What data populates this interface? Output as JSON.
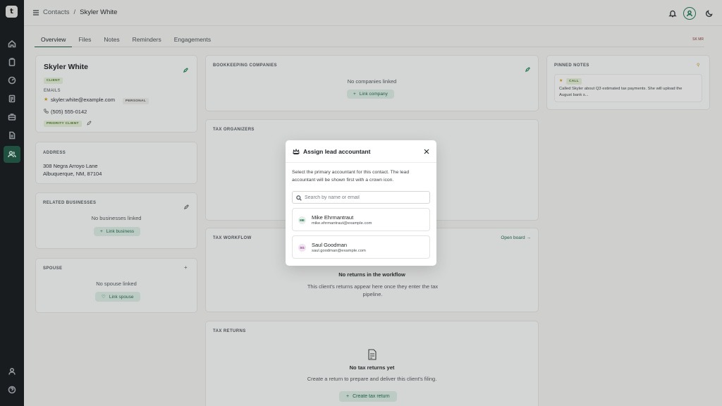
{
  "logo": {
    "glyph": "t"
  },
  "sidebar": {
    "items": [
      {
        "icon": "home-icon"
      },
      {
        "icon": "clipboard-icon"
      },
      {
        "icon": "gauge-icon"
      },
      {
        "icon": "document-icon"
      },
      {
        "icon": "briefcase-icon"
      },
      {
        "icon": "file-icon"
      },
      {
        "icon": "users-icon",
        "active": true
      }
    ],
    "bottom": [
      {
        "icon": "user-icon"
      },
      {
        "icon": "help-icon"
      }
    ]
  },
  "breadcrumb": {
    "section": "Contacts",
    "separator": "/",
    "current": "Skyler White"
  },
  "tabs": [
    "Overview",
    "Files",
    "Notes",
    "Reminders",
    "Engagements"
  ],
  "flags_label": "SK MR",
  "contact": {
    "name": "Skyler White",
    "type_badge": "CLIENT",
    "emails_label": "EMAILS",
    "email": "skyler.white@example.com",
    "email_tag": "PERSONAL",
    "phone": "(505) 555-0142",
    "priority_badge": "PRIORITY CLIENT"
  },
  "address": {
    "label": "ADDRESS",
    "line1": "308 Negra Arroyo Lane",
    "line2": "Albuquerque, NM, 87104"
  },
  "related": {
    "label": "RELATED BUSINESSES",
    "empty": "No businesses linked",
    "button": "Link business"
  },
  "spouse": {
    "label": "SPOUSE",
    "empty": "No spouse linked",
    "button": "Link spouse"
  },
  "bookkeeping": {
    "label": "BOOKKEEPING COMPANIES",
    "empty": "No companies linked",
    "button": "Link company"
  },
  "tax_organizers": {
    "label": "TAX ORGANIZERS"
  },
  "tax_workflow": {
    "label": "TAX WORKFLOW",
    "link": "Open board",
    "empty_title": "No returns in the workflow",
    "empty_desc": "This client's returns appear here once they enter the tax pipeline."
  },
  "tax_returns": {
    "label": "TAX RETURNS",
    "empty_title": "No tax returns yet",
    "empty_desc": "Create a return to prepare and deliver this client's filing.",
    "button": "Create tax return"
  },
  "pinned": {
    "label": "PINNED NOTES",
    "tag": "CALL",
    "text": "Called Skyler about Q3 estimated tax payments. She will upload the August bank s..."
  },
  "modal": {
    "title": "Assign lead accountant",
    "description": "Select the primary accountant for this contact. The lead accountant will be shown first with a crown icon.",
    "search_placeholder": "Search by name or email",
    "options": [
      {
        "initials": "ME",
        "name": "Mike Ehrmantraut",
        "email": "mike.ehrmantraut@example.com",
        "color": "#e3efe8",
        "text_color": "#1f6a4d"
      },
      {
        "initials": "SG",
        "name": "Saul Goodman",
        "email": "saul.goodman@example.com",
        "color": "#f1e4f1",
        "text_color": "#8a3a8a"
      }
    ]
  }
}
